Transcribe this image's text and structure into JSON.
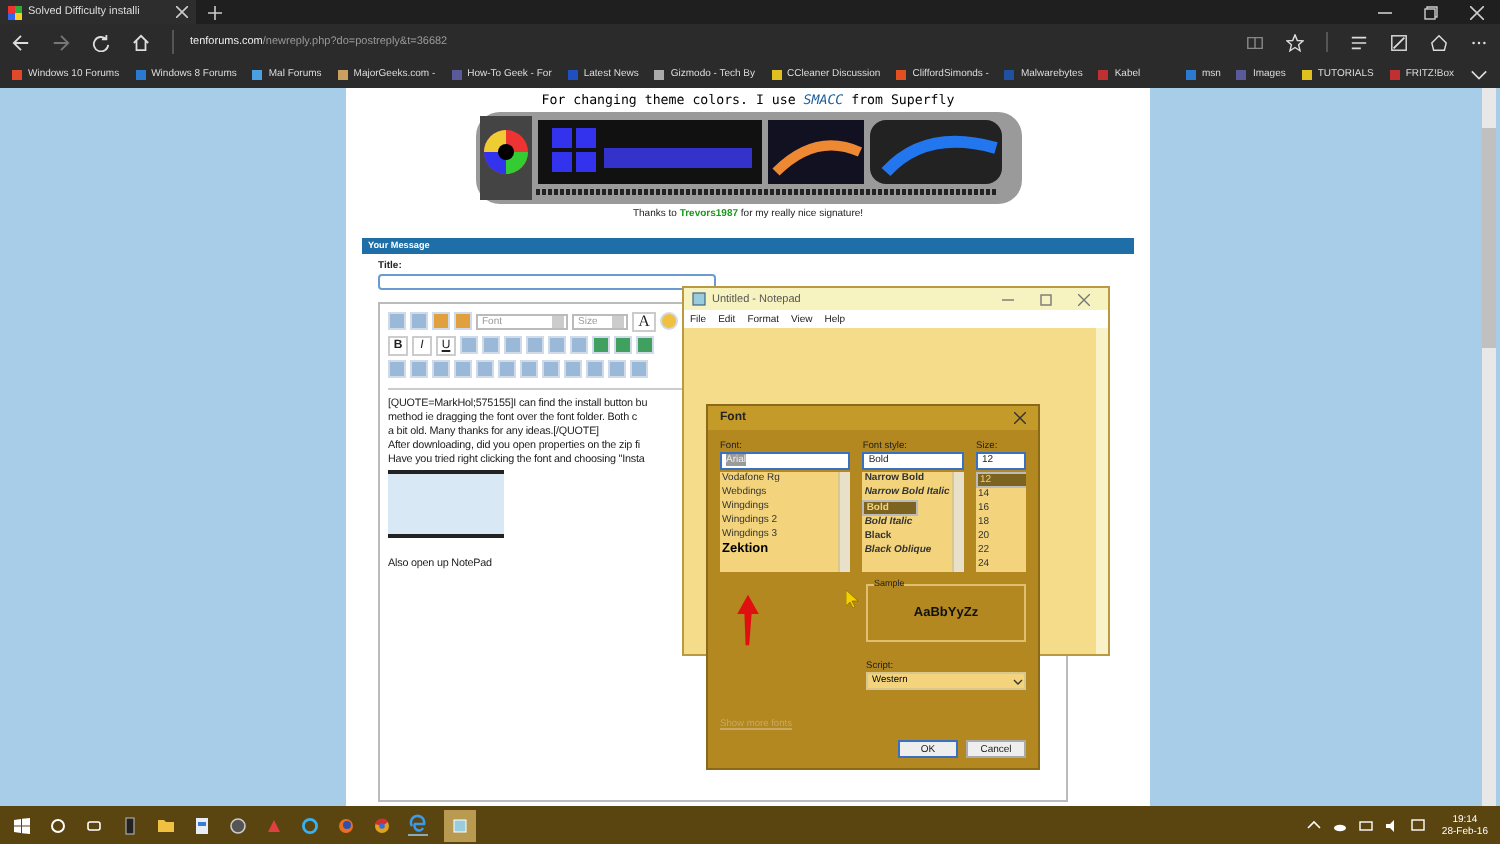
{
  "browser": {
    "tab": {
      "title": "Solved Difficulty installi"
    },
    "address": {
      "domain": "tenforums.com",
      "path": "/newreply.php?do=postreply&t=36682"
    },
    "favorites": [
      "Windows 10 Forums",
      "Windows 8 Forums",
      "Mal Forums",
      "MajorGeeks.com -",
      "How-To Geek - For",
      "Latest News",
      "Gizmodo - Tech By",
      "CCleaner Discussion",
      "CliffordSimonds -",
      "Malwarebytes",
      "Kabel"
    ],
    "favorites_right": [
      "msn",
      "Images",
      "TUTORIALS",
      "FRITZ!Box"
    ]
  },
  "signature": {
    "line": {
      "before": "For changing theme colors. I use ",
      "link": "SMACC",
      "after": " from Superfly"
    },
    "thanks": {
      "before": "Thanks to ",
      "link": "Trevors1987",
      "after": " for my really nice signature!"
    }
  },
  "message_panel": {
    "header": "Your Message",
    "title_label": "Title:",
    "editor": {
      "font_select": "Font",
      "size_select": "Size",
      "color_button": "A",
      "format_buttons": [
        "B",
        "I",
        "U"
      ],
      "lines": [
        "[QUOTE=MarkHol;575155]I can find the install button bu",
        "method ie dragging the font over the font folder. Both c",
        "a bit old. Many thanks for any ideas.[/QUOTE]",
        "After downloading, did you open properties on the zip fi",
        "Have you tried right clicking the font and choosing \"Insta"
      ],
      "after_image": "Also open up NotePad"
    }
  },
  "notepad": {
    "title": "Untitled - Notepad",
    "menu": [
      "File",
      "Edit",
      "Format",
      "View",
      "Help"
    ]
  },
  "font_dialog": {
    "title": "Font",
    "font_label": "Font:",
    "font_value": "Arial",
    "style_label": "Font style:",
    "style_value": "Bold",
    "size_label": "Size:",
    "size_value": "12",
    "fonts": [
      {
        "label": "Vodafone Rg",
        "selected": false
      },
      {
        "label": "Webdings",
        "selected": false
      },
      {
        "label": "Wingdings",
        "selected": false
      },
      {
        "label": "Wingdings 2",
        "selected": false
      },
      {
        "label": "Wingdings 3",
        "selected": false
      },
      {
        "label": "Zektion",
        "selected": false
      }
    ],
    "styles": [
      {
        "label": "Narrow Bold",
        "selected": false
      },
      {
        "label": "Narrow Bold Italic",
        "selected": false
      },
      {
        "label": "Bold",
        "selected": true
      },
      {
        "label": "Bold Italic",
        "selected": false
      },
      {
        "label": "Black",
        "selected": false
      },
      {
        "label": "Black Oblique",
        "selected": false
      }
    ],
    "sizes": [
      {
        "label": "12",
        "selected": true
      },
      {
        "label": "14",
        "selected": false
      },
      {
        "label": "16",
        "selected": false
      },
      {
        "label": "18",
        "selected": false
      },
      {
        "label": "20",
        "selected": false
      },
      {
        "label": "22",
        "selected": false
      },
      {
        "label": "24",
        "selected": false
      }
    ],
    "sample_label": "Sample",
    "sample_text": "AaBbYyZz",
    "script_label": "Script:",
    "script_value": "Western",
    "more_fonts_link": "Show more fonts",
    "buttons": [
      "OK",
      "Cancel"
    ]
  },
  "taskbar": {
    "time": "19:14",
    "date": "28-Feb-16"
  }
}
